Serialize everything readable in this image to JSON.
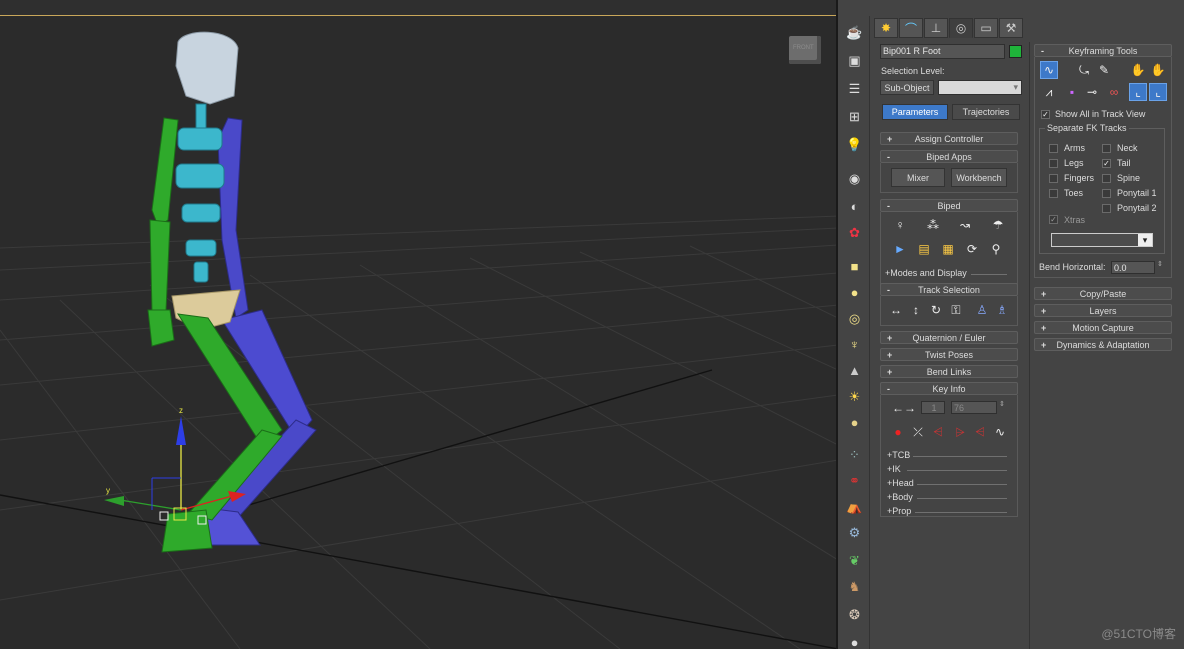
{
  "viewport": {
    "viewcube_label": "FRONT",
    "gizmo_axis": {
      "z": "z",
      "y": "y"
    }
  },
  "icon_strip": [
    "teapot-icon",
    "render-setup-icon",
    "list-icon",
    "schematic-icon",
    "light-icon",
    "camera-icon",
    "helper-icon",
    "particle-icon",
    "box-icon",
    "sphere-icon",
    "torus-icon",
    "pyramid-icon",
    "pine-icon",
    "sun-icon",
    "geosphere-icon",
    "grid-icon",
    "molecule-icon",
    "tent-icon",
    "gear-icon",
    "plant-icon",
    "horse-icon",
    "shell-icon",
    "ball-icon"
  ],
  "command_panel": {
    "tabs": [
      "create-icon",
      "modify-icon",
      "hierarchy-icon",
      "motion-icon",
      "display-icon",
      "utilities-icon"
    ],
    "object_name": "Bip001 R Foot",
    "object_color": "#1fb33a",
    "selection_level_label": "Selection Level:",
    "sub_object_label": "Sub-Object",
    "sub_object_value": "",
    "parameters_tab": "Parameters",
    "trajectories_tab": "Trajectories",
    "assign_controller": {
      "sign": "+",
      "title": "Assign Controller"
    },
    "biped_apps": {
      "sign": "-",
      "title": "Biped Apps",
      "mixer": "Mixer",
      "workbench": "Workbench"
    },
    "biped": {
      "sign": "-",
      "title": "Biped",
      "row1": [
        "figure-mode-icon",
        "footstep-mode-icon",
        "motion-flow-icon",
        "mixer-mode-icon"
      ],
      "row2": [
        "biped-playback-icon",
        "load-file-icon",
        "save-file-icon",
        "convert-icon",
        "move-all-icon"
      ],
      "modes_display": "+Modes and Display"
    },
    "track_selection": {
      "sign": "-",
      "title": "Track Selection",
      "icons": [
        "body-horizontal-icon",
        "body-vertical-icon",
        "body-rotation-icon",
        "lock-cog-icon",
        "symmetrical-icon",
        "opposite-icon"
      ]
    },
    "quaternion": {
      "sign": "+",
      "title": "Quaternion / Euler"
    },
    "twist_poses": {
      "sign": "+",
      "title": "Twist Poses"
    },
    "bend_links": {
      "sign": "+",
      "title": "Bend Links"
    },
    "key_info": {
      "sign": "-",
      "title": "Key Info",
      "key_number": "1",
      "key_time": "76",
      "key_icons": [
        "set-key-icon",
        "set-free-key-icon",
        "set-sliding-key-icon",
        "set-planted-key-icon",
        "set-free-key-2-icon",
        "curve-icon"
      ],
      "sub_rollouts": [
        "+TCB",
        "+IK",
        "+Head",
        "+Body",
        "+Prop"
      ]
    },
    "keyframing_tools": {
      "sign": "-",
      "title": "Keyframing Tools",
      "row1": [
        "curves-icon",
        "set-parents-mode-icon",
        "eraser-icon",
        "anchor-left-hand-icon",
        "anchor-right-hand-icon"
      ],
      "row2": [
        "delete-keys-icon",
        "set-multiple-keys-icon",
        "clear-selected-icon",
        "mirror-icon",
        "anchor-left-foot-icon",
        "anchor-right-foot-icon"
      ],
      "show_all_track_view": "Show All in Track View",
      "show_all_checked": true,
      "separate_fk_tracks": "Separate FK Tracks",
      "tracks_left": [
        {
          "label": "Arms",
          "checked": false
        },
        {
          "label": "Legs",
          "checked": false
        },
        {
          "label": "Fingers",
          "checked": false
        },
        {
          "label": "Toes",
          "checked": false
        }
      ],
      "tracks_right": [
        {
          "label": "Neck",
          "checked": false
        },
        {
          "label": "Tail",
          "checked": true
        },
        {
          "label": "Spine",
          "checked": false
        },
        {
          "label": "Ponytail 1",
          "checked": false
        },
        {
          "label": "Ponytail 2",
          "checked": false
        }
      ],
      "xtras": {
        "label": "Xtras",
        "checked": true
      },
      "xtras_dropdown": "",
      "bend_horizontal_label": "Bend Horizontal:",
      "bend_horizontal_value": "0.0"
    },
    "copy_paste": {
      "sign": "+",
      "title": "Copy/Paste"
    },
    "layers": {
      "sign": "+",
      "title": "Layers"
    },
    "motion_capture": {
      "sign": "+",
      "title": "Motion Capture"
    },
    "dynamics": {
      "sign": "+",
      "title": "Dynamics & Adaptation"
    }
  },
  "watermark": "@51CTO博客"
}
